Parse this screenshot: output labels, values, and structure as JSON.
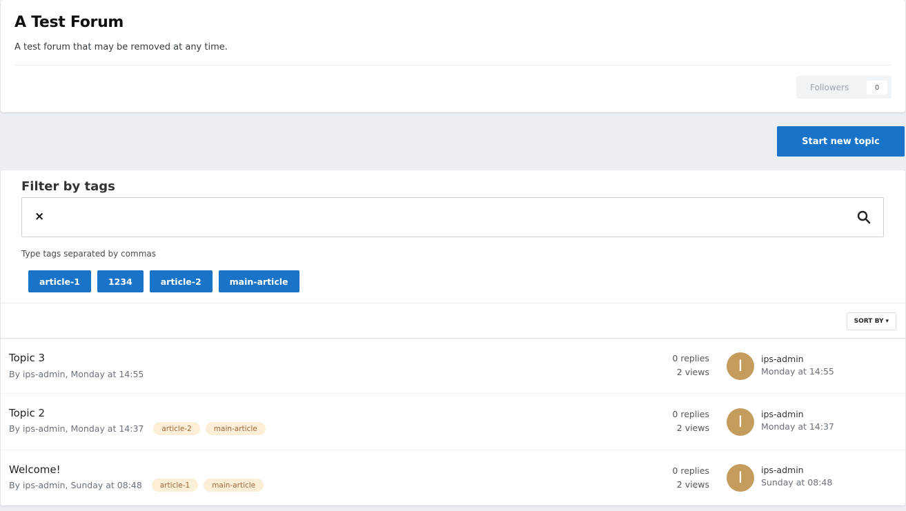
{
  "forum": {
    "title": "A Test Forum",
    "description": "A test forum that may be removed at any time.",
    "followers_label": "Followers",
    "followers_count": "0"
  },
  "actions": {
    "start_topic_label": "Start new topic"
  },
  "filter": {
    "title": "Filter by tags",
    "input_value": "",
    "clear_icon": "×",
    "hint": "Type tags separated by commas",
    "tags": [
      "article-1",
      "1234",
      "article-2",
      "main-article"
    ]
  },
  "sort": {
    "label": "SORT BY",
    "caret": "▾"
  },
  "topics": [
    {
      "title": "Topic 3",
      "meta": "By ips-admin, Monday at 14:55",
      "tags": [],
      "replies": "0 replies",
      "views": "2 views",
      "avatar_letter": "I",
      "last_poster": "ips-admin",
      "last_time": "Monday at 14:55"
    },
    {
      "title": "Topic 2",
      "meta": "By ips-admin, Monday at 14:37",
      "tags": [
        "article-2",
        "main-article"
      ],
      "replies": "0 replies",
      "views": "2 views",
      "avatar_letter": "I",
      "last_poster": "ips-admin",
      "last_time": "Monday at 14:37"
    },
    {
      "title": "Welcome!",
      "meta": "By ips-admin, Sunday at 08:48",
      "tags": [
        "article-1",
        "main-article"
      ],
      "replies": "0 replies",
      "views": "2 views",
      "avatar_letter": "I",
      "last_poster": "ips-admin",
      "last_time": "Sunday at 08:48"
    }
  ],
  "colors": {
    "accent": "#1873c9",
    "avatar": "#c49c5c",
    "tag_bg": "#fdeed7",
    "tag_text": "#a0683a"
  }
}
